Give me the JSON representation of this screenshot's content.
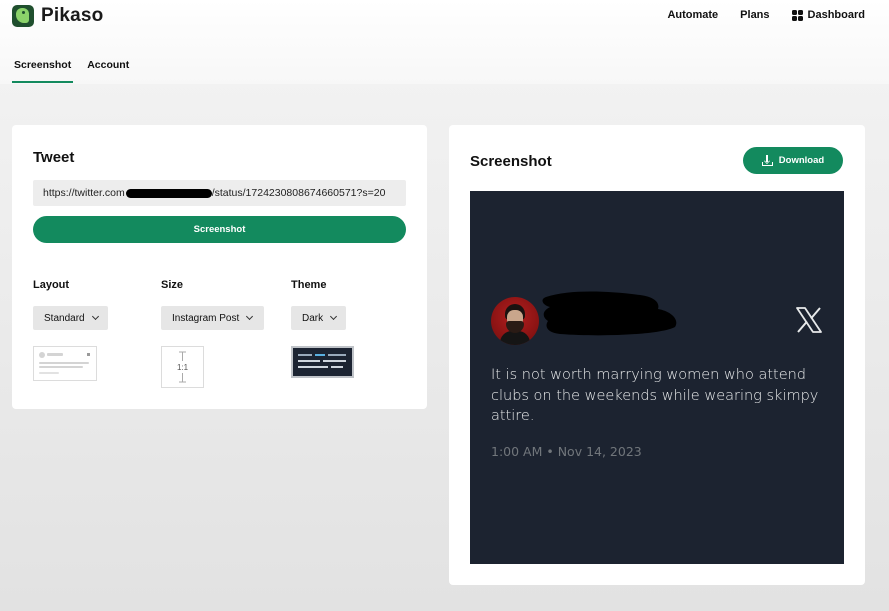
{
  "app": {
    "name": "Pikaso"
  },
  "nav": {
    "automate": "Automate",
    "plans": "Plans",
    "dashboard": "Dashboard"
  },
  "tabs": [
    {
      "label": "Screenshot",
      "active": true
    },
    {
      "label": "Account",
      "active": false
    }
  ],
  "tweet_panel": {
    "title": "Tweet",
    "url_prefix": "https://twitter.com",
    "url_suffix": "/status/1724230808674660571?s=20",
    "screenshot_button": "Screenshot",
    "options": {
      "layout": {
        "label": "Layout",
        "value": "Standard"
      },
      "size": {
        "label": "Size",
        "value": "Instagram Post",
        "ratio": "1:1"
      },
      "theme": {
        "label": "Theme",
        "value": "Dark"
      }
    }
  },
  "preview_panel": {
    "title": "Screenshot",
    "download_button": "Download",
    "tweet": {
      "text": "It is not worth marrying women who attend clubs on the weekends while wearing skimpy attire.",
      "date": "1:00 AM • Nov 14, 2023"
    }
  },
  "colors": {
    "accent": "#138a5e",
    "tweet_bg": "#1c2330",
    "avatar_bg": "#a31919"
  },
  "icons": [
    "logo-icon",
    "dashboard-grid-icon",
    "chevron-down-icon",
    "download-icon",
    "x-logo-icon"
  ]
}
